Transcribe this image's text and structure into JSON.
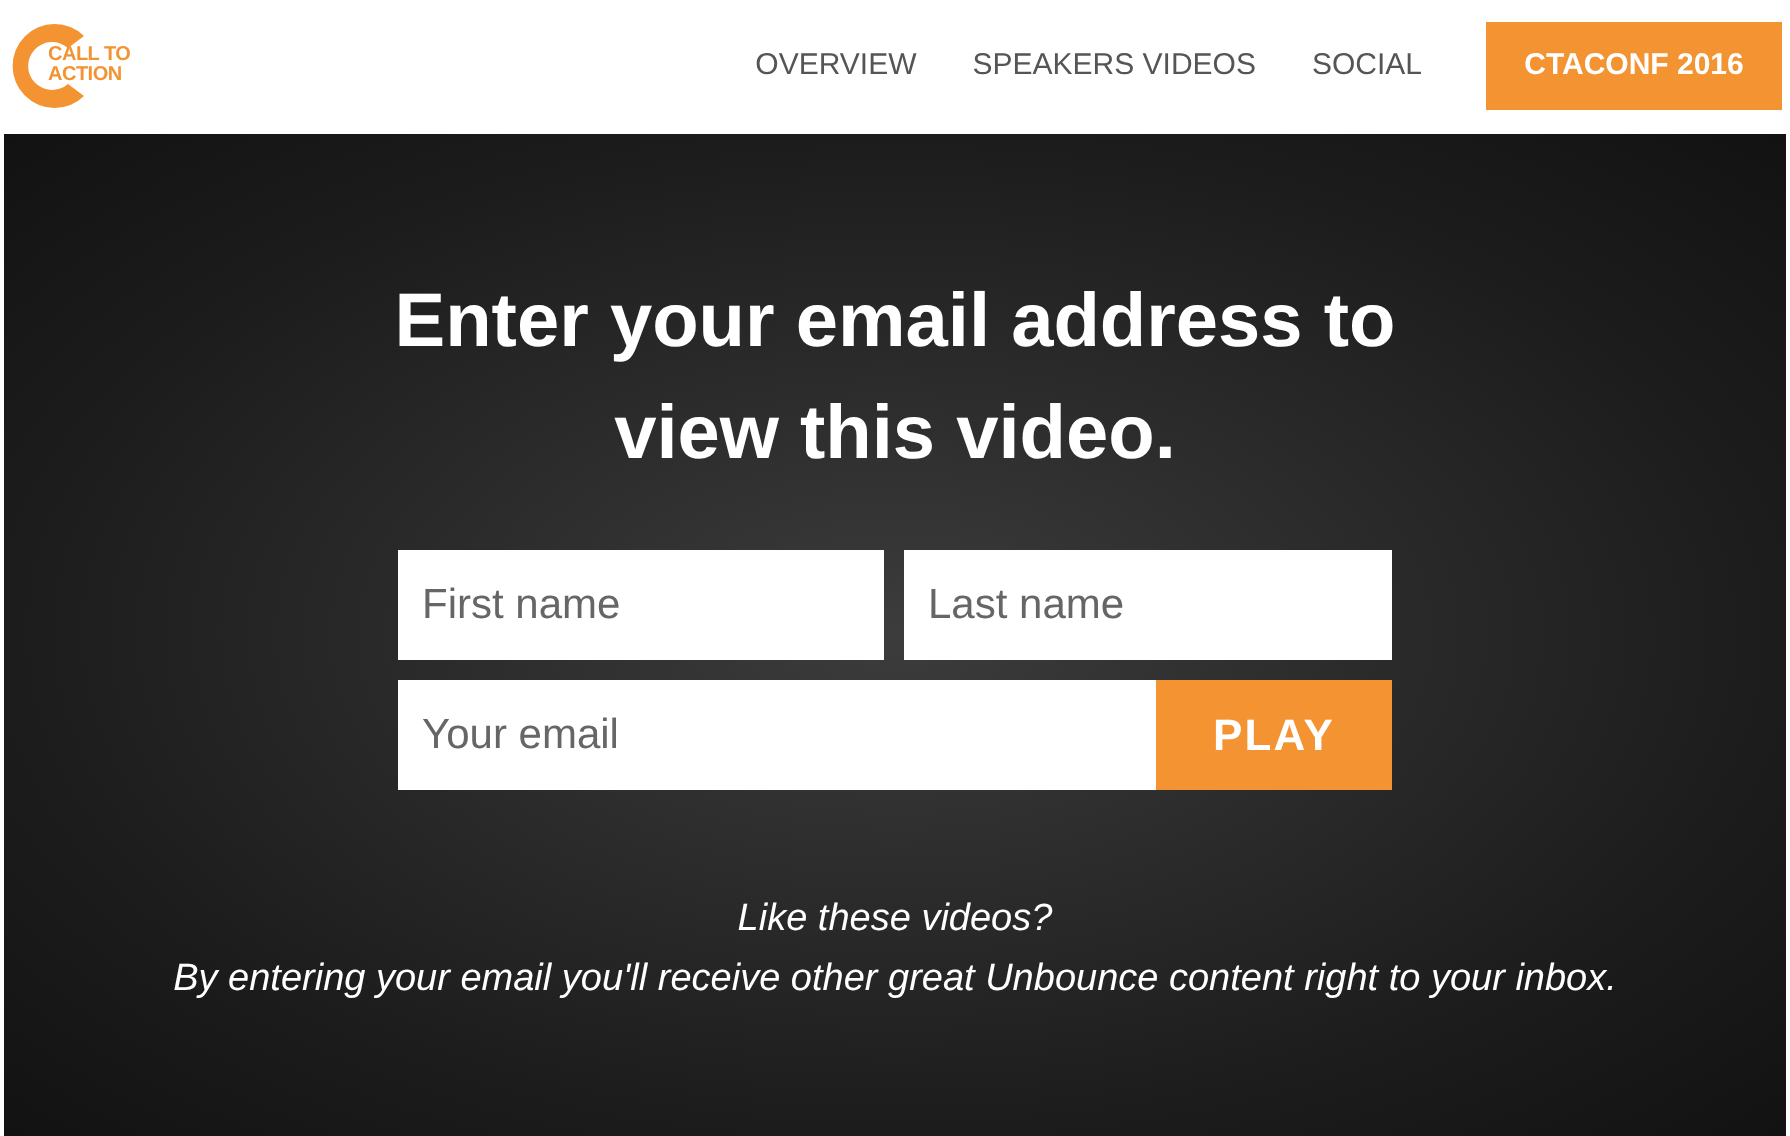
{
  "logo": {
    "line_1": "CALL TO",
    "line_2": "ACTION"
  },
  "nav": [
    {
      "label": "OVERVIEW"
    },
    {
      "label": "SPEAKERS VIDEOS"
    },
    {
      "label": "SOCIAL"
    }
  ],
  "cta_button": "CTACONF 2016",
  "heading": "Enter your email address to view this video.",
  "form": {
    "first_name": {
      "placeholder": "First name"
    },
    "last_name": {
      "placeholder": "Last name"
    },
    "email": {
      "placeholder": "Your email"
    },
    "submit": "PLAY"
  },
  "note": {
    "line_1": "Like these videos?",
    "line_2": "By entering your email you'll receive other great Unbounce content right to your inbox."
  }
}
